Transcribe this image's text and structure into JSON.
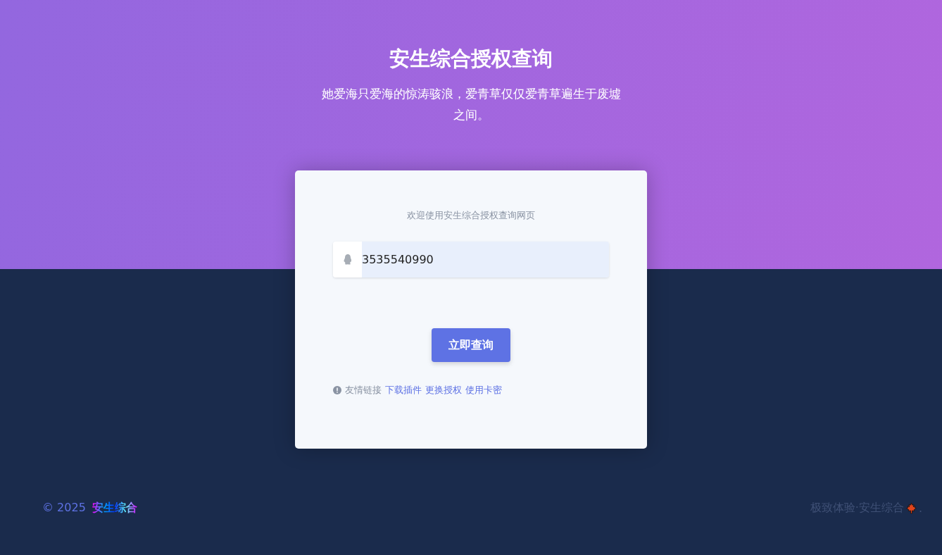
{
  "header": {
    "title": "安生综合授权查询",
    "subtitle": "她爱海只爱海的惊涛骇浪，爱青草仅仅爱青草遍生于废墟之间。"
  },
  "card": {
    "welcome": "欢迎使用安生综合授权查询网页",
    "input": {
      "value": "3535540990"
    },
    "button": "立即查询",
    "links_label": "友情链接",
    "links": [
      "下载插件",
      "更换授权",
      "使用卡密"
    ]
  },
  "footer": {
    "copyright": "© 2025",
    "brand": "安生综合",
    "tagline": "极致体验·安生综合",
    "tail": "."
  }
}
